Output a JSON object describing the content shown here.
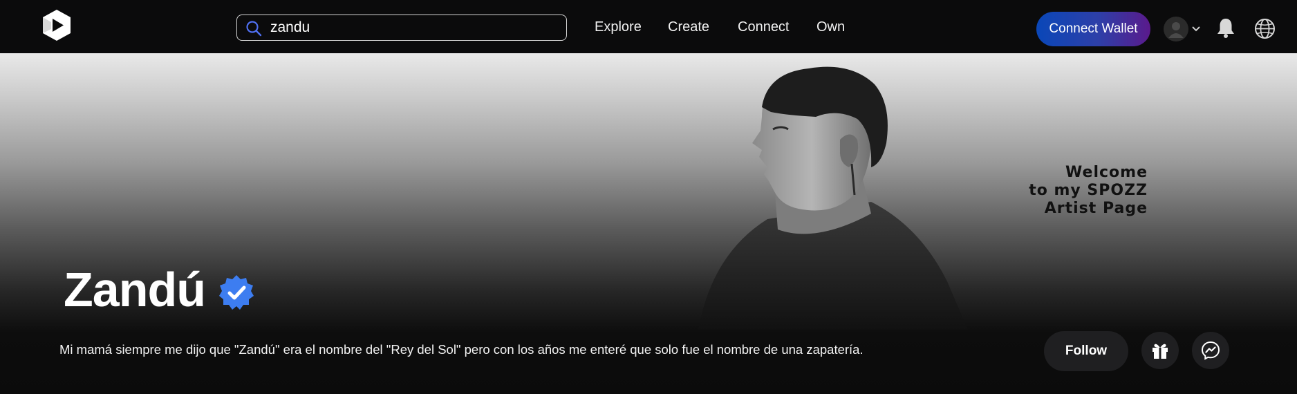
{
  "header": {
    "search": {
      "value": "zandu",
      "placeholder": ""
    },
    "nav": [
      "Explore",
      "Create",
      "Connect",
      "Own"
    ],
    "connect_wallet_label": "Connect Wallet"
  },
  "banner": {
    "welcome_lines": [
      "Welcome",
      "to my SPOZZ",
      "Artist Page"
    ]
  },
  "profile": {
    "name": "Zandú",
    "verified": true,
    "bio": "Mi mamá siempre me dijo que \"Zandú\" era el nombre del \"Rey del Sol\" pero con los años me enteré que solo fue el nombre de una zapatería.",
    "follow_label": "Follow"
  },
  "icons": [
    "spozz-logo-icon",
    "search-icon",
    "user-avatar-icon",
    "chevron-down-icon",
    "bell-icon",
    "globe-icon",
    "verified-badge-icon",
    "gift-icon",
    "messenger-icon"
  ],
  "colors": {
    "background": "#0c0c0c",
    "wallet_gradient_start": "#0a47b8",
    "wallet_gradient_end": "#5a1a8c",
    "verified_blue": "#3d7df0",
    "button_dark": "#1f1f21"
  }
}
